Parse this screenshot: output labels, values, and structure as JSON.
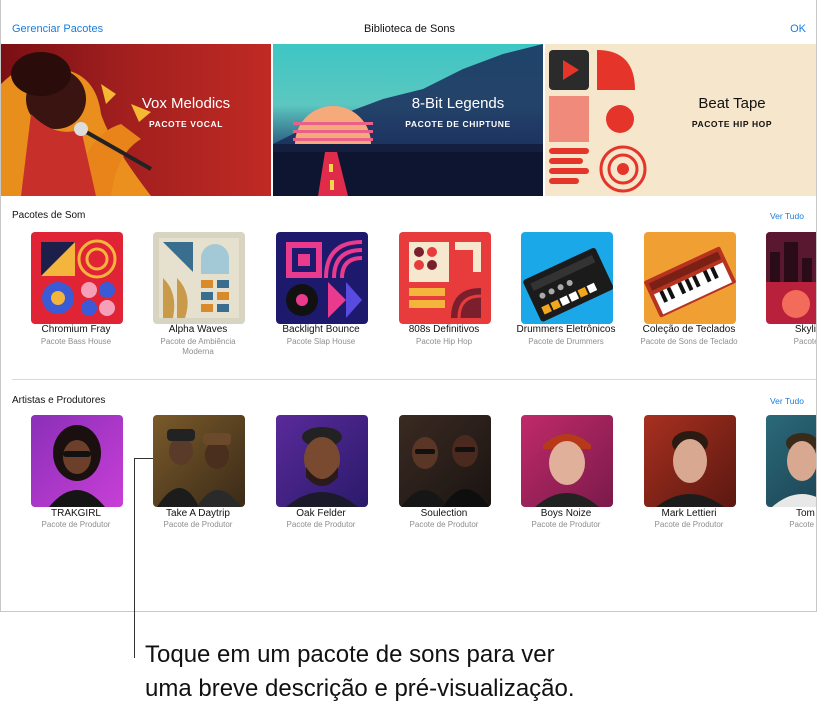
{
  "navbar": {
    "left_label": "Gerenciar Pacotes",
    "title": "Biblioteca de Sons",
    "right_label": "OK"
  },
  "banners": [
    {
      "title": "Vox Melodics",
      "subtitle": "PACOTE VOCAL"
    },
    {
      "title": "8-Bit Legends",
      "subtitle": "PACOTE DE CHIPTUNE"
    },
    {
      "title": "Beat Tape",
      "subtitle": "PACOTE HIP HOP"
    }
  ],
  "sound_packs": {
    "title": "Pacotes de Som",
    "see_all": "Ver Tudo",
    "items": [
      {
        "name": "Chromium Fray",
        "type": "Pacote Bass House"
      },
      {
        "name": "Alpha Waves",
        "type": "Pacote de Ambiência Moderna"
      },
      {
        "name": "Backlight Bounce",
        "type": "Pacote Slap House"
      },
      {
        "name": "808s Definitivos",
        "type": "Pacote Hip Hop"
      },
      {
        "name": "Drummers Eletrônicos",
        "type": "Pacote de Drummers"
      },
      {
        "name": "Coleção de Teclados",
        "type": "Pacote de Sons de Teclado"
      },
      {
        "name": "Skyline",
        "type": "Pacote Hi"
      }
    ]
  },
  "artists": {
    "title": "Artistas e Produtores",
    "see_all": "Ver Tudo",
    "items": [
      {
        "name": "TRAKGIRL",
        "type": "Pacote de Produtor"
      },
      {
        "name": "Take A Daytrip",
        "type": "Pacote de Produtor"
      },
      {
        "name": "Oak Felder",
        "type": "Pacote de Produtor"
      },
      {
        "name": "Soulection",
        "type": "Pacote de Produtor"
      },
      {
        "name": "Boys Noize",
        "type": "Pacote de Produtor"
      },
      {
        "name": "Mark Lettieri",
        "type": "Pacote de Produtor"
      },
      {
        "name": "Tom M",
        "type": "Pacote de P"
      }
    ]
  },
  "callout": {
    "line1": "Toque em um pacote de sons para ver",
    "line2": "uma breve descrição e pré-visualização."
  }
}
